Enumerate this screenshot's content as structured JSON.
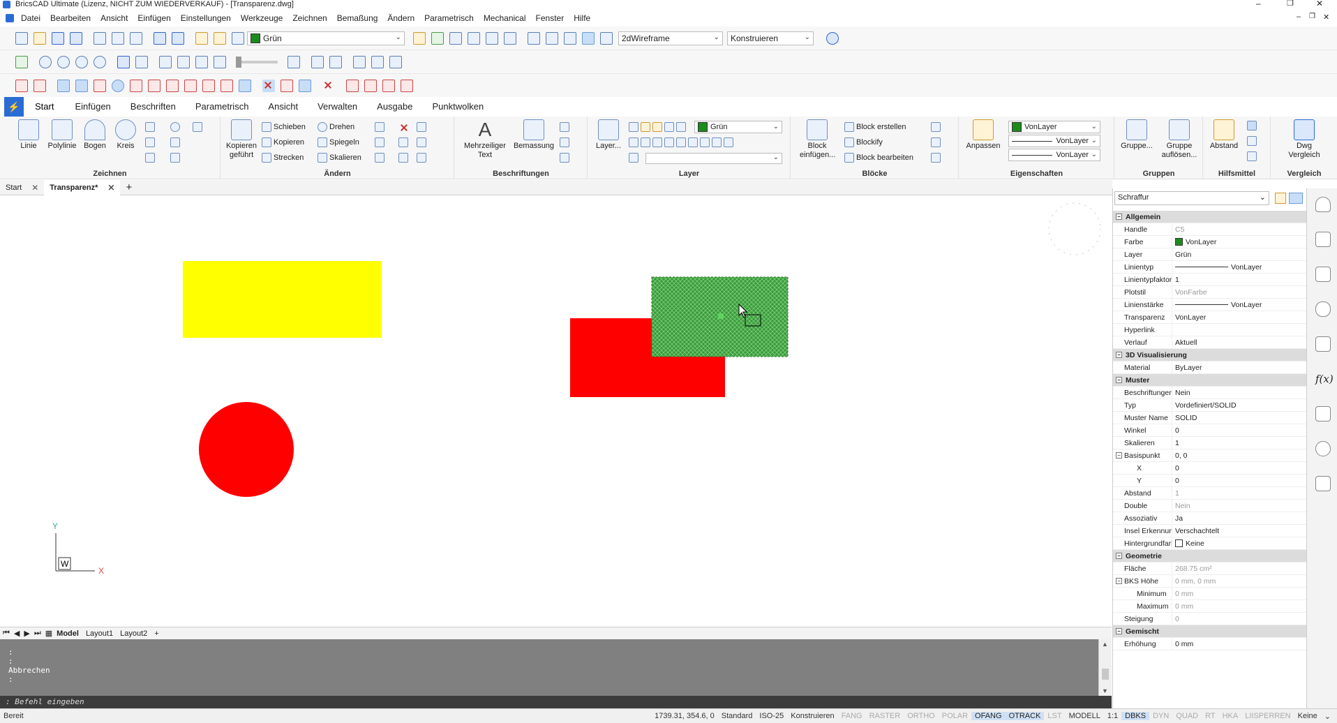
{
  "window": {
    "title": "BricsCAD Ultimate (Lizenz, NICHT ZUM WIEDERVERKAUF) - [Transparenz.dwg]"
  },
  "menu": [
    "Datei",
    "Bearbeiten",
    "Ansicht",
    "Einfügen",
    "Einstellungen",
    "Werkzeuge",
    "Zeichnen",
    "Bemaßung",
    "Ändern",
    "Parametrisch",
    "Mechanical",
    "Fenster",
    "Hilfe"
  ],
  "toolbar": {
    "layer_value": "Grün",
    "visual_style": "2dWireframe",
    "workspace": "Konstruieren"
  },
  "ribbon_tabs": [
    "Start",
    "Einfügen",
    "Beschriften",
    "Parametrisch",
    "Ansicht",
    "Verwalten",
    "Ausgabe",
    "Punktwolken"
  ],
  "ribbon": {
    "zeichnen": {
      "label": "Zeichnen",
      "linie": "Linie",
      "polylinie": "Polylinie",
      "bogen": "Bogen",
      "kreis": "Kreis"
    },
    "aendern": {
      "label": "Ändern",
      "kopieren_gefuehrt_1": "Kopieren",
      "kopieren_gefuehrt_2": "geführt",
      "schieben": "Schieben",
      "kopieren": "Kopieren",
      "strecken": "Strecken",
      "drehen": "Drehen",
      "spiegeln": "Spiegeln",
      "skalieren": "Skalieren"
    },
    "beschriftungen": {
      "label": "Beschriftungen",
      "mtext_1": "Mehrzeiliger",
      "mtext_2": "Text",
      "bemassung": "Bemassung"
    },
    "layer": {
      "label": "Layer",
      "layer_btn": "Layer...",
      "layer_value": "Grün"
    },
    "bloecke": {
      "label": "Blöcke",
      "einfuegen_1": "Block",
      "einfuegen_2": "einfügen...",
      "erstellen": "Block erstellen",
      "blockify": "Blockify",
      "bearbeiten": "Block bearbeiten"
    },
    "eigenschaften": {
      "label": "Eigenschaften",
      "anpassen": "Anpassen",
      "color": "VonLayer",
      "linetype": "VonLayer",
      "lineweight": "VonLayer"
    },
    "gruppen": {
      "label": "Gruppen",
      "gruppe": "Gruppe...",
      "aufloesen_1": "Gruppe",
      "aufloesen_2": "auflösen..."
    },
    "hilfsmittel": {
      "label": "Hilfsmittel",
      "abstand": "Abstand"
    },
    "vergleich": {
      "label": "Vergleich",
      "dwg_1": "Dwg",
      "dwg_2": "Vergleich"
    }
  },
  "doc_tabs": [
    {
      "label": "Start",
      "active": false
    },
    {
      "label": "Transparenz*",
      "active": true
    }
  ],
  "layout_tabs": [
    "Model",
    "Layout1",
    "Layout2"
  ],
  "ucs": {
    "y": "Y",
    "x": "X",
    "w": "W"
  },
  "command": {
    "lines": [
      ":",
      ":",
      "Abbrechen",
      ":"
    ],
    "prompt": ": Befehl eingeben"
  },
  "properties": {
    "selector": "Schraffur",
    "rows": [
      {
        "type": "cat",
        "label": "Allgemein"
      },
      {
        "k": "Handle",
        "v": "C5",
        "dim": true
      },
      {
        "k": "Farbe",
        "v": "VonLayer",
        "swatch": "#1e8a1e"
      },
      {
        "k": "Layer",
        "v": "Grün"
      },
      {
        "k": "Linientyp",
        "v": "VonLayer",
        "line": true
      },
      {
        "k": "Linientypfaktor",
        "v": "1"
      },
      {
        "k": "Plotstil",
        "v": "VonFarbe",
        "dim": true
      },
      {
        "k": "Linienstärke",
        "v": "VonLayer",
        "line": true
      },
      {
        "k": "Transparenz",
        "v": "VonLayer"
      },
      {
        "k": "Hyperlink",
        "v": ""
      },
      {
        "k": "Verlauf",
        "v": "Aktuell"
      },
      {
        "type": "cat",
        "label": "3D Visualisierung"
      },
      {
        "k": "Material",
        "v": "ByLayer"
      },
      {
        "type": "cat",
        "label": "Muster"
      },
      {
        "k": "Beschriftungen",
        "v": "Nein"
      },
      {
        "k": "Typ",
        "v": "Vordefiniert/SOLID"
      },
      {
        "k": "Muster Name",
        "v": "SOLID"
      },
      {
        "k": "Winkel",
        "v": "0"
      },
      {
        "k": "Skalieren",
        "v": "1"
      },
      {
        "k": "Basispunkt",
        "v": "0, 0",
        "toggle": true
      },
      {
        "k": "X",
        "v": "0",
        "ind": true
      },
      {
        "k": "Y",
        "v": "0",
        "ind": true
      },
      {
        "k": "Abstand",
        "v": "1",
        "dim": true
      },
      {
        "k": "Double",
        "v": "Nein",
        "dim": true
      },
      {
        "k": "Assoziativ",
        "v": "Ja"
      },
      {
        "k": "Insel Erkennung",
        "v": "Verschachtelt"
      },
      {
        "k": "Hintergrundfarbe",
        "v": "Keine",
        "box": true
      },
      {
        "type": "cat",
        "label": "Geometrie"
      },
      {
        "k": "Fläche",
        "v": "268.75 cm²",
        "dim": true
      },
      {
        "k": "BKS Höhe",
        "v": "0 mm, 0 mm",
        "dim": true,
        "toggle": true
      },
      {
        "k": "Minimum",
        "v": "0 mm",
        "dim": true,
        "ind": true
      },
      {
        "k": "Maximum",
        "v": "0 mm",
        "dim": true,
        "ind": true
      },
      {
        "k": "Steigung",
        "v": "0",
        "dim": true
      },
      {
        "type": "cat",
        "label": "Gemischt"
      },
      {
        "k": "Erhöhung",
        "v": "0 mm"
      }
    ]
  },
  "status": {
    "left": "Bereit",
    "coords": "1739.31, 354.6, 0",
    "items": [
      {
        "t": "Standard",
        "s": "n"
      },
      {
        "t": "ISO-25",
        "s": "n"
      },
      {
        "t": "Konstruieren",
        "s": "n"
      },
      {
        "t": "FANG",
        "s": "off"
      },
      {
        "t": "RASTER",
        "s": "off"
      },
      {
        "t": "ORTHO",
        "s": "off"
      },
      {
        "t": "POLAR",
        "s": "off"
      },
      {
        "t": "OFANG",
        "s": "on"
      },
      {
        "t": "OTRACK",
        "s": "on"
      },
      {
        "t": "LST",
        "s": "off"
      },
      {
        "t": "MODELL",
        "s": "n"
      },
      {
        "t": "1:1",
        "s": "n"
      },
      {
        "t": "DBKS",
        "s": "on"
      },
      {
        "t": "DYN",
        "s": "off"
      },
      {
        "t": "QUAD",
        "s": "off"
      },
      {
        "t": "RT",
        "s": "off"
      },
      {
        "t": "HKA",
        "s": "off"
      },
      {
        "t": "LIISPERREN",
        "s": "off"
      },
      {
        "t": "Keine",
        "s": "n"
      }
    ]
  },
  "colors": {
    "yellow": "#ffff00",
    "red": "#ff0000",
    "green": "#2e8b2e"
  }
}
